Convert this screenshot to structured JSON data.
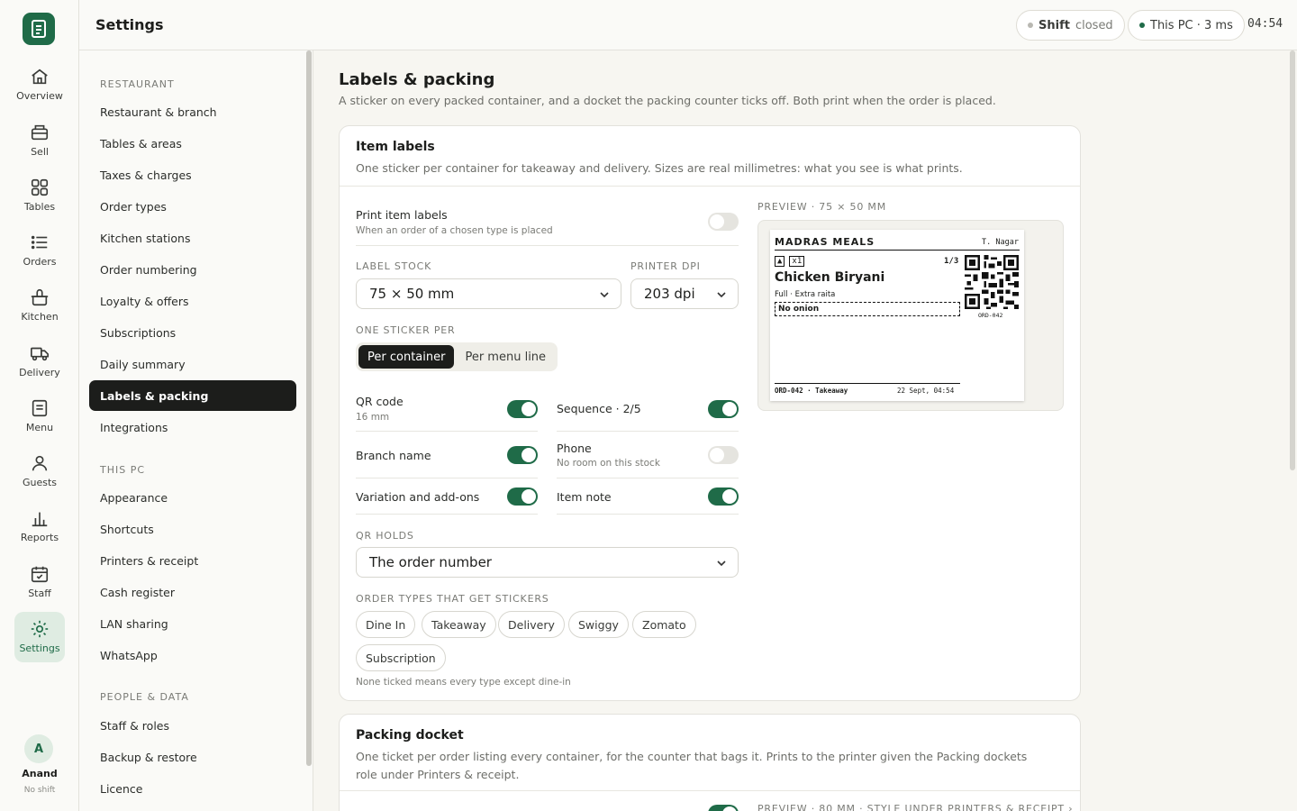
{
  "rail": {
    "items": [
      {
        "label": "Overview",
        "icon": "home-icon"
      },
      {
        "label": "Sell",
        "icon": "register-icon"
      },
      {
        "label": "Tables",
        "icon": "grid-icon"
      },
      {
        "label": "Orders",
        "icon": "list-icon"
      },
      {
        "label": "Kitchen",
        "icon": "pot-icon"
      },
      {
        "label": "Delivery",
        "icon": "truck-icon"
      },
      {
        "label": "Menu",
        "icon": "menu-doc-icon"
      },
      {
        "label": "Guests",
        "icon": "person-icon"
      },
      {
        "label": "Reports",
        "icon": "bar-chart-icon"
      },
      {
        "label": "Staff",
        "icon": "calendar-check-icon"
      },
      {
        "label": "Settings",
        "icon": "sun-gear-icon",
        "active": true
      }
    ],
    "user": {
      "initial": "A",
      "name": "Anand",
      "status": "No shift"
    }
  },
  "topbar": {
    "title": "Settings",
    "shift_label": "Shift",
    "shift_status": "closed",
    "pc_status": "This PC · 3 ms",
    "clock": "04:54"
  },
  "subnav": {
    "sections": [
      {
        "heading": "RESTAURANT",
        "items": [
          "Restaurant & branch",
          "Tables & areas",
          "Taxes & charges",
          "Order types",
          "Kitchen stations",
          "Order numbering",
          "Loyalty & offers",
          "Subscriptions",
          "Daily summary",
          "Labels & packing",
          "Integrations"
        ]
      },
      {
        "heading": "THIS PC",
        "items": [
          "Appearance",
          "Shortcuts",
          "Printers & receipt",
          "Cash register",
          "LAN sharing",
          "WhatsApp"
        ]
      },
      {
        "heading": "PEOPLE & DATA",
        "items": [
          "Staff & roles",
          "Backup & restore",
          "Licence"
        ]
      }
    ],
    "active": "Labels & packing"
  },
  "page": {
    "title": "Labels & packing",
    "subtitle": "A sticker on every packed container, and a docket the packing counter ticks off. Both print when the order is placed."
  },
  "item_labels": {
    "title": "Item labels",
    "subtitle": "One sticker per container for takeaway and delivery. Sizes are real millimetres: what you see is what prints.",
    "print_toggle": {
      "label": "Print item labels",
      "sub": "When an order of a chosen type is placed",
      "on": false
    },
    "label_stock": {
      "label": "LABEL STOCK",
      "value": "75 × 50 mm"
    },
    "printer_dpi": {
      "label": "PRINTER DPI",
      "value": "203 dpi"
    },
    "one_sticker_per": {
      "label": "ONE STICKER PER",
      "options": [
        "Per container",
        "Per menu line"
      ],
      "selected": "Per container"
    },
    "fields": [
      {
        "label": "QR code",
        "sub": "16 mm",
        "on": true
      },
      {
        "label": "Sequence · 2/5",
        "sub": "",
        "on": true
      },
      {
        "label": "Branch name",
        "sub": "",
        "on": true
      },
      {
        "label": "Phone",
        "sub": "No room on this stock",
        "on": false
      },
      {
        "label": "Variation and add-ons",
        "sub": "",
        "on": true
      },
      {
        "label": "Item note",
        "sub": "",
        "on": true
      }
    ],
    "qr_holds": {
      "label": "QR HOLDS",
      "value": "The order number"
    },
    "order_types": {
      "label": "ORDER TYPES THAT GET STICKERS",
      "chips": [
        "Dine In",
        "Takeaway",
        "Delivery",
        "Swiggy",
        "Zomato",
        "Subscription"
      ],
      "hint": "None ticked means every type except dine-in"
    },
    "preview": {
      "heading": "PREVIEW · 75 × 50 MM",
      "brand": "MADRAS MEALS",
      "branch": "T. Nagar",
      "seq": "1/3",
      "icon1": "▲",
      "icon2": "x1",
      "item": "Chicken Biryani",
      "variation": "Full · Extra raita",
      "note": "No onion",
      "qr_caption": "ORD-042",
      "footer_left": "ORD-042 · Takeaway",
      "footer_right": "22 Sept, 04:54"
    }
  },
  "packing_docket": {
    "title": "Packing docket",
    "subtitle": "One ticket per order listing every container, for the counter that bags it. Prints to the printer given the Packing dockets role under Printers & receipt.",
    "preview_heading": "PREVIEW · 80 MM · STYLE UNDER PRINTERS & RECEIPT ›"
  },
  "colors": {
    "accent": "#1f6b48",
    "accent_soft": "#dfece2",
    "dark": "#1c1d1b",
    "background": "#f7f6f1"
  }
}
